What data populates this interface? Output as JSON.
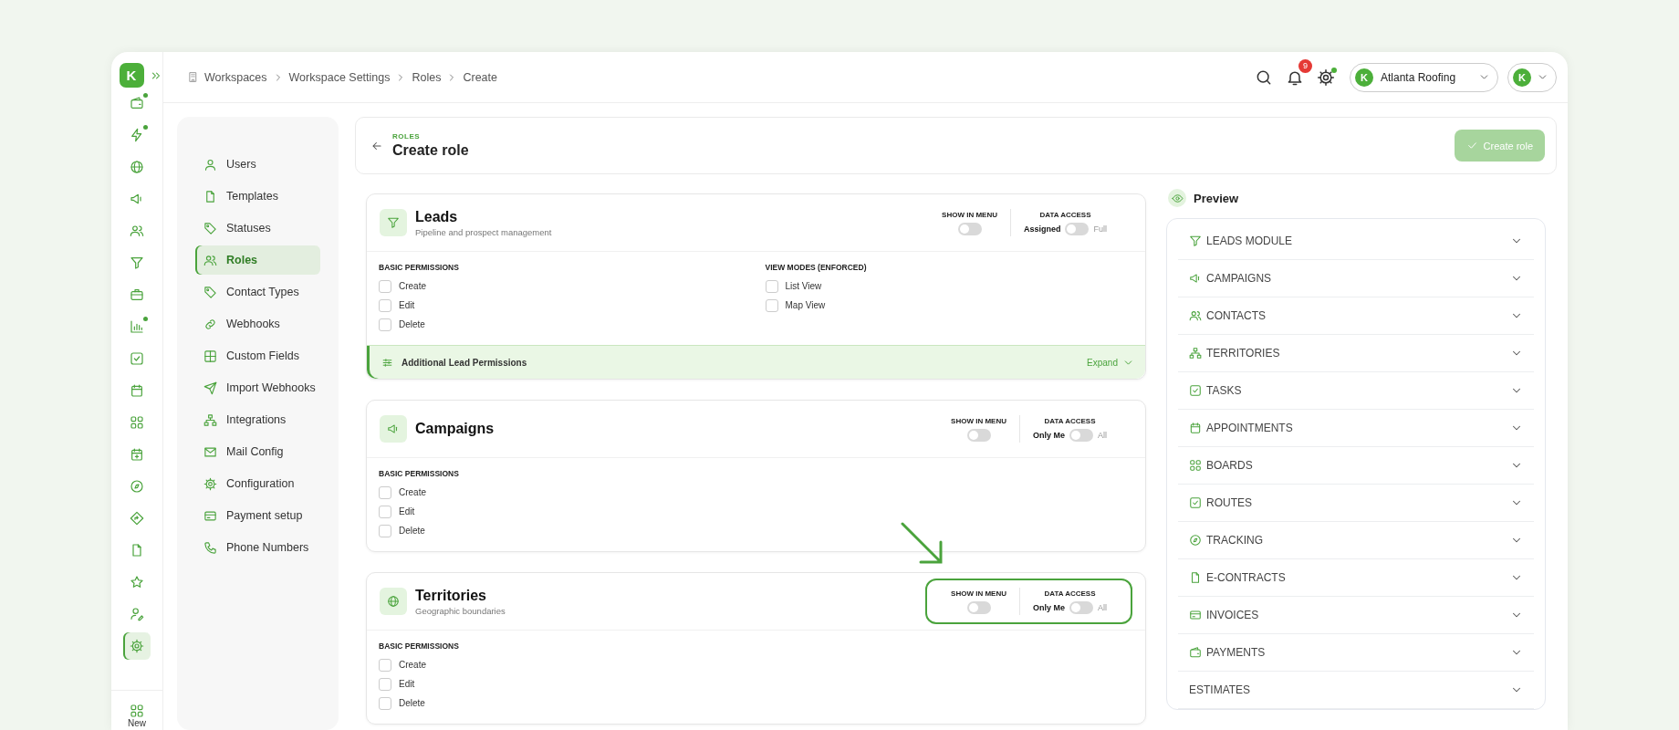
{
  "rail": {
    "logo": "K",
    "items": [
      {
        "selected": false,
        "badge": true
      },
      {
        "selected": false,
        "badge": true
      },
      {
        "selected": false,
        "badge": false
      },
      {
        "selected": false,
        "badge": false
      },
      {
        "selected": false,
        "badge": false
      },
      {
        "selected": false,
        "badge": false
      },
      {
        "selected": false,
        "badge": false
      },
      {
        "selected": false,
        "badge": true
      },
      {
        "selected": false,
        "badge": false
      },
      {
        "selected": false,
        "badge": false
      },
      {
        "selected": false,
        "badge": false
      },
      {
        "selected": false,
        "badge": false
      },
      {
        "selected": false,
        "badge": false
      },
      {
        "selected": false,
        "badge": false
      },
      {
        "selected": false,
        "badge": false
      },
      {
        "selected": false,
        "badge": false
      },
      {
        "selected": false,
        "badge": false
      },
      {
        "selected": true,
        "badge": false
      }
    ],
    "new_label": "New"
  },
  "breadcrumb": [
    {
      "label": "Workspaces"
    },
    {
      "label": "Workspace Settings"
    },
    {
      "label": "Roles"
    },
    {
      "label": "Create"
    }
  ],
  "topbar": {
    "notification_count": "9",
    "settings_badge": true,
    "workspace": {
      "avatar": "K",
      "name": "Atlanta Roofing"
    },
    "user_avatar": "K"
  },
  "settings_menu": [
    {
      "label": "Users",
      "selected": false
    },
    {
      "label": "Templates",
      "selected": false
    },
    {
      "label": "Statuses",
      "selected": false
    },
    {
      "label": "Roles",
      "selected": true
    },
    {
      "label": "Contact Types",
      "selected": false
    },
    {
      "label": "Webhooks",
      "selected": false
    },
    {
      "label": "Custom Fields",
      "selected": false
    },
    {
      "label": "Import Webhooks",
      "selected": false
    },
    {
      "label": "Integrations",
      "selected": false
    },
    {
      "label": "Mail Config",
      "selected": false
    },
    {
      "label": "Configuration",
      "selected": false
    },
    {
      "label": "Payment setup",
      "selected": false
    },
    {
      "label": "Phone Numbers",
      "selected": false
    }
  ],
  "header": {
    "eyebrow": "ROLES",
    "title": "Create role",
    "button": {
      "label": "Create role",
      "disabled": true
    }
  },
  "modules": [
    {
      "title": "Leads",
      "subtitle": "Pipeline and prospect management",
      "highlighted": false,
      "show_in_menu": {
        "label": "SHOW IN MENU",
        "on": false
      },
      "data_access": {
        "label": "DATA ACCESS",
        "left": "Assigned",
        "right": "Full",
        "on": false
      },
      "sections": [
        {
          "heading": "BASIC PERMISSIONS",
          "items": [
            {
              "label": "Create",
              "checked": false
            },
            {
              "label": "Edit",
              "checked": false
            },
            {
              "label": "Delete",
              "checked": false
            }
          ]
        },
        {
          "heading": "VIEW MODES (ENFORCED)",
          "items": [
            {
              "label": "List View",
              "checked": false
            },
            {
              "label": "Map View",
              "checked": false
            }
          ]
        }
      ],
      "additional": {
        "label": "Additional Lead Permissions",
        "action": "Expand",
        "expanded": false
      }
    },
    {
      "title": "Campaigns",
      "highlighted": false,
      "show_in_menu": {
        "label": "SHOW IN MENU",
        "on": false
      },
      "data_access": {
        "label": "DATA ACCESS",
        "left": "Only Me",
        "right": "All",
        "on": false
      },
      "sections": [
        {
          "heading": "BASIC PERMISSIONS",
          "items": [
            {
              "label": "Create",
              "checked": false
            },
            {
              "label": "Edit",
              "checked": false
            },
            {
              "label": "Delete",
              "checked": false
            }
          ]
        }
      ]
    },
    {
      "title": "Territories",
      "subtitle": "Geographic boundaries",
      "highlighted": true,
      "show_in_menu": {
        "label": "SHOW IN MENU",
        "on": false
      },
      "data_access": {
        "label": "DATA ACCESS",
        "left": "Only Me",
        "right": "All",
        "on": false
      },
      "sections": [
        {
          "heading": "BASIC PERMISSIONS",
          "items": [
            {
              "label": "Create",
              "checked": false
            },
            {
              "label": "Edit",
              "checked": false
            },
            {
              "label": "Delete",
              "checked": false
            }
          ]
        }
      ]
    }
  ],
  "preview": {
    "title": "Preview",
    "items": [
      {
        "label": "LEADS MODULE",
        "expanded": false
      },
      {
        "label": "CAMPAIGNS",
        "expanded": false
      },
      {
        "label": "CONTACTS",
        "expanded": false
      },
      {
        "label": "TERRITORIES",
        "expanded": false
      },
      {
        "label": "TASKS",
        "expanded": false
      },
      {
        "label": "APPOINTMENTS",
        "expanded": false
      },
      {
        "label": "BOARDS",
        "expanded": false
      },
      {
        "label": "ROUTES",
        "expanded": false
      },
      {
        "label": "TRACKING",
        "expanded": false
      },
      {
        "label": "E-CONTRACTS",
        "expanded": false
      },
      {
        "label": "INVOICES",
        "expanded": false
      },
      {
        "label": "PAYMENTS",
        "expanded": false
      },
      {
        "label": "ESTIMATES",
        "expanded": false
      }
    ]
  }
}
